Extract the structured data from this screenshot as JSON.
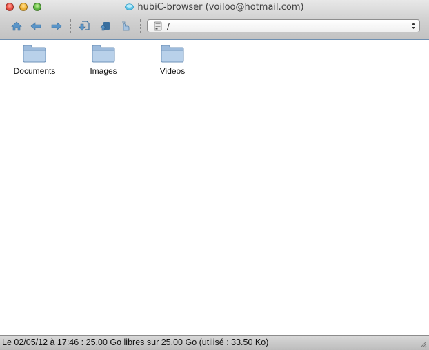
{
  "window": {
    "title": "hubiC-browser (voiloo@hotmail.com)"
  },
  "toolbar": {
    "buttons": [
      {
        "name": "home-icon"
      },
      {
        "name": "back-arrow-icon"
      },
      {
        "name": "forward-arrow-icon"
      },
      {
        "name": "download-icon"
      },
      {
        "name": "upload-icon"
      },
      {
        "name": "share-icon"
      }
    ],
    "path": {
      "value": "/",
      "icon": "drive-icon"
    }
  },
  "files": [
    {
      "label": "Documents",
      "icon": "folder-icon"
    },
    {
      "label": "Images",
      "icon": "folder-icon"
    },
    {
      "label": "Videos",
      "icon": "folder-icon"
    }
  ],
  "status": {
    "text": "Le 02/05/12 à 17:46 : 25.00 Go libres sur 25.00 Go (utilisé : 33.50 Ko)"
  },
  "colors": {
    "accent": "#4a86b8",
    "folder": "#a9c4e2",
    "border": "#6e8fb0"
  }
}
